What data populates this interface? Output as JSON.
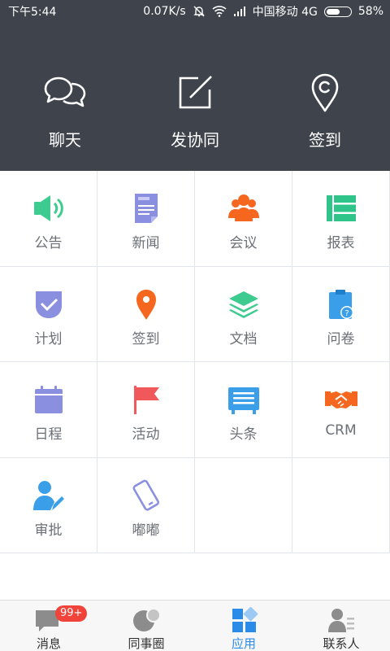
{
  "status_bar": {
    "time": "下午5:44",
    "speed": "0.07K/s",
    "carrier": "中国移动 4G",
    "battery": "58%"
  },
  "header": {
    "items": [
      {
        "label": "聊天",
        "icon": "chat-icon"
      },
      {
        "label": "发协同",
        "icon": "edit-icon"
      },
      {
        "label": "签到",
        "icon": "location-icon"
      }
    ]
  },
  "grid": {
    "items": [
      {
        "label": "公告",
        "icon": "speaker-icon",
        "color": "#3ecb8f"
      },
      {
        "label": "新闻",
        "icon": "news-icon",
        "color": "#8b8fe0"
      },
      {
        "label": "会议",
        "icon": "meeting-icon",
        "color": "#f5671f"
      },
      {
        "label": "报表",
        "icon": "report-icon",
        "color": "#2fc48a"
      },
      {
        "label": "计划",
        "icon": "plan-icon",
        "color": "#8b8fe0"
      },
      {
        "label": "签到",
        "icon": "map-pin-icon",
        "color": "#f5671f"
      },
      {
        "label": "文档",
        "icon": "layers-icon",
        "color": "#3ecb8f"
      },
      {
        "label": "问卷",
        "icon": "questionnaire-icon",
        "color": "#3a9ee8"
      },
      {
        "label": "日程",
        "icon": "calendar-icon",
        "color": "#8b8fe0"
      },
      {
        "label": "活动",
        "icon": "flag-icon",
        "color": "#f0585c"
      },
      {
        "label": "头条",
        "icon": "headline-icon",
        "color": "#3a9ee8"
      },
      {
        "label": "CRM",
        "icon": "handshake-icon",
        "color": "#f5671f"
      },
      {
        "label": "审批",
        "icon": "approval-icon",
        "color": "#3a9ee8"
      },
      {
        "label": "嘟嘟",
        "icon": "phone-icon",
        "color": "#8b8fe0"
      }
    ]
  },
  "tabbar": {
    "items": [
      {
        "label": "消息",
        "icon": "message-icon"
      },
      {
        "label": "同事圈",
        "icon": "colleague-icon"
      },
      {
        "label": "应用",
        "icon": "apps-icon"
      },
      {
        "label": "联系人",
        "icon": "contacts-icon"
      }
    ],
    "badge": "99+",
    "active_color": "#2a8be8"
  }
}
